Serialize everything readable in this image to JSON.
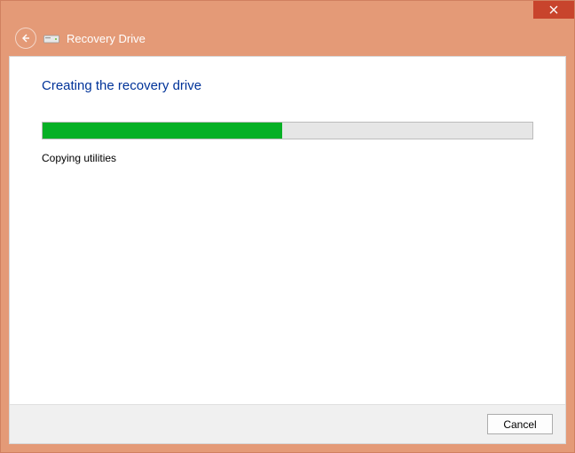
{
  "window": {
    "title": "Recovery Drive"
  },
  "main": {
    "heading": "Creating the recovery drive",
    "progress_percent": 49,
    "status": "Copying utilities"
  },
  "footer": {
    "cancel_label": "Cancel"
  },
  "colors": {
    "frame": "#e49a77",
    "close": "#c8442c",
    "progress": "#06b025",
    "title": "#003399"
  }
}
